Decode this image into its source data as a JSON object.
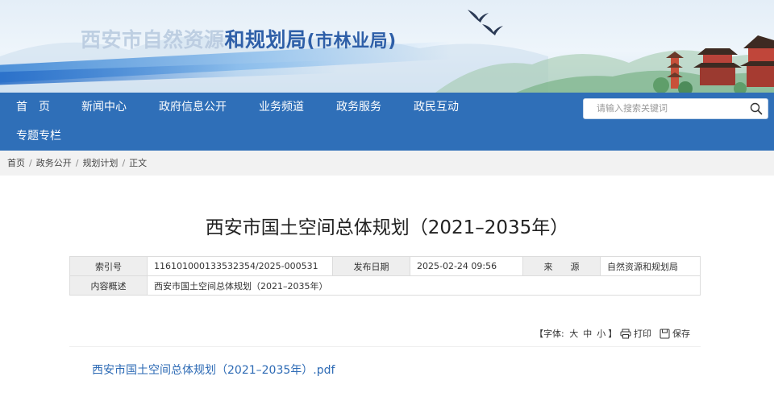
{
  "header": {
    "site_title_faded": "西安市自然资源",
    "site_title_main": "和规划局",
    "site_title_sub": "(市林业局)"
  },
  "nav": {
    "items": [
      "首　页",
      "新闻中心",
      "政府信息公开",
      "业务频道",
      "政务服务",
      "政民互动",
      "专题专栏"
    ]
  },
  "search": {
    "placeholder": "请输入搜索关键词"
  },
  "breadcrumb": {
    "items": [
      "首页",
      "政务公开",
      "规划计划",
      "正文"
    ],
    "separator": "/"
  },
  "article": {
    "title": "西安市国土空间总体规划（2021–2035年）",
    "meta": {
      "index_label": "索引号",
      "index_value": "116101000133532354/2025-000531",
      "date_label": "发布日期",
      "date_value": "2025-02-24 09:56",
      "source_label": "来　　源",
      "source_value": "自然资源和规划局",
      "summary_label": "内容概述",
      "summary_value": "西安市国土空间总体规划（2021–2035年）"
    },
    "tools": {
      "font_label": "【字体:",
      "size_large": "大",
      "size_medium": "中",
      "size_small": "小",
      "font_close": "】",
      "print_label": "打印",
      "save_label": "保存"
    },
    "attachment": "西安市国土空间总体规划（2021–2035年）.pdf"
  },
  "colors": {
    "nav_bg": "#2f6fb8",
    "link": "#2e6bb5",
    "title_blue": "#2e5fa8"
  }
}
